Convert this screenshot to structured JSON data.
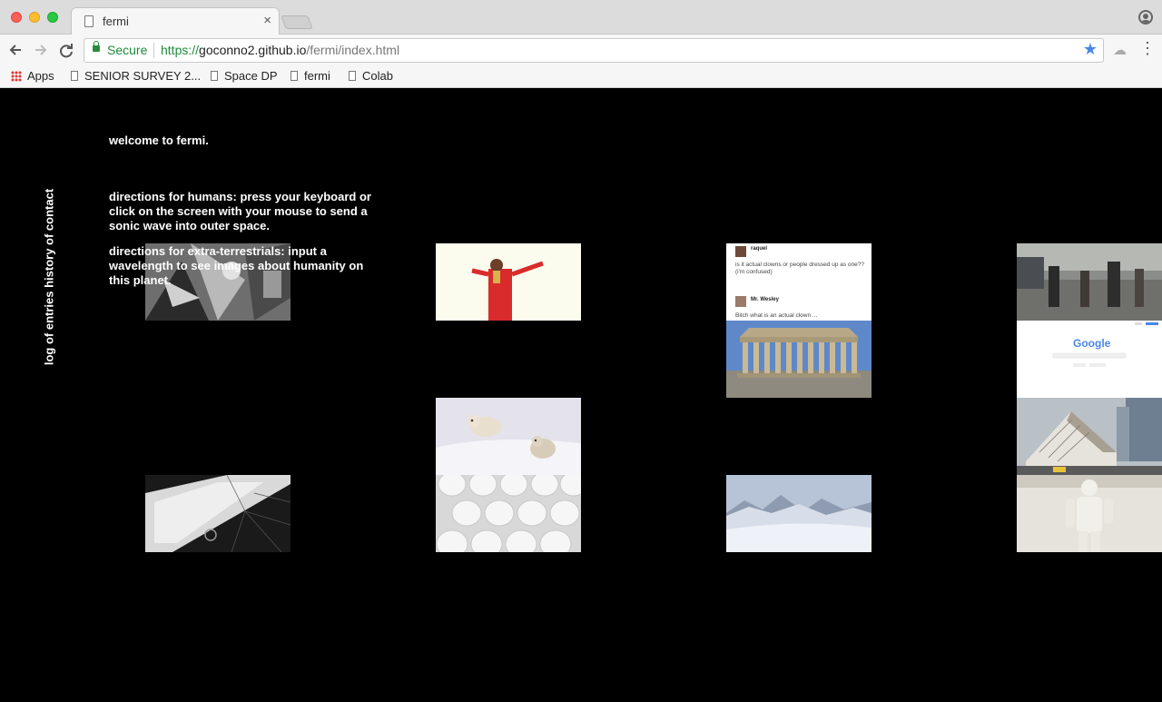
{
  "browser": {
    "tab_title": "fermi",
    "tab_close": "×",
    "secure_label": "Secure",
    "url_scheme": "https://",
    "url_host": "goconno2.github.io",
    "url_path": "/fermi/index.html",
    "bookmarks": [
      "Apps",
      "SENIOR SURVEY 2...",
      "Space DP",
      "fermi",
      "Colab"
    ]
  },
  "page": {
    "nav_vertical": "log of entries history of contact",
    "welcome": "welcome to fermi.",
    "directions_humans": "directions for humans: press your keyboard or click on the screen with your mouse to send a sonic wave into outer space.",
    "directions_et": "directions for extra-terrestrials: input a wavelength to see images about humanity on this planet.",
    "tweet": {
      "user1": "raquel",
      "text1": "is it actual clowns or people dressed up as one?? (i'm confused)",
      "user2": "Mr. Wesley",
      "text2": "Bitch what is an actual clown ..."
    },
    "google_logo": "Google"
  },
  "images": [
    "guernica-painting",
    "kanye-red-suit",
    "tweet-screenshot",
    "street-crowd-photo",
    "parthenon-photo",
    "google-homepage-screenshot",
    "polar-bears-photo",
    "modern-building-photo",
    "cracked-phone-screen",
    "eggs-photo",
    "snowy-mountains-photo",
    "david-statue-photo"
  ]
}
